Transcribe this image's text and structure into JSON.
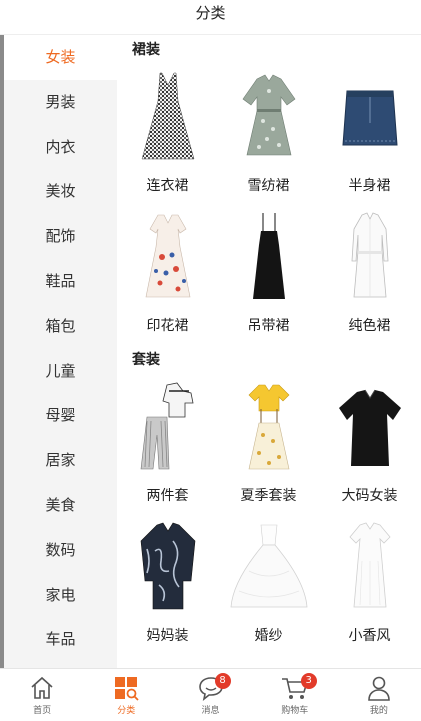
{
  "header": {
    "title": "分类"
  },
  "sidebar": {
    "items": [
      {
        "label": "女装",
        "active": true
      },
      {
        "label": "男装"
      },
      {
        "label": "内衣"
      },
      {
        "label": "美妆"
      },
      {
        "label": "配饰"
      },
      {
        "label": "鞋品"
      },
      {
        "label": "箱包"
      },
      {
        "label": "儿童"
      },
      {
        "label": "母婴"
      },
      {
        "label": "居家"
      },
      {
        "label": "美食"
      },
      {
        "label": "数码"
      },
      {
        "label": "家电"
      },
      {
        "label": "车品"
      }
    ]
  },
  "main": {
    "sections": [
      {
        "title": "裙装",
        "items": [
          {
            "label": "连衣裙",
            "icon": "gingham-dress"
          },
          {
            "label": "雪纺裙",
            "icon": "chiffon-dress"
          },
          {
            "label": "半身裙",
            "icon": "denim-skirt"
          },
          {
            "label": "印花裙",
            "icon": "print-dress"
          },
          {
            "label": "吊带裙",
            "icon": "slip-dress"
          },
          {
            "label": "纯色裙",
            "icon": "solid-dress"
          }
        ]
      },
      {
        "title": "套装",
        "items": [
          {
            "label": "两件套",
            "icon": "two-piece-set"
          },
          {
            "label": "夏季套装",
            "icon": "summer-set"
          },
          {
            "label": "大码女装",
            "icon": "plus-size-top"
          },
          {
            "label": "妈妈装",
            "icon": "mom-blouse"
          },
          {
            "label": "婚纱",
            "icon": "wedding-gown"
          },
          {
            "label": "小香风",
            "icon": "chanel-style-dress"
          }
        ]
      }
    ]
  },
  "tabbar": {
    "tabs": [
      {
        "label": "首页",
        "icon": "home-icon"
      },
      {
        "label": "分类",
        "icon": "category-icon",
        "active": true
      },
      {
        "label": "消息",
        "icon": "message-icon",
        "badge": "8"
      },
      {
        "label": "购物车",
        "icon": "cart-icon",
        "badge": "3"
      },
      {
        "label": "我的",
        "icon": "profile-icon"
      }
    ]
  },
  "colors": {
    "accent": "#ee6a22",
    "badge": "#e23b2a",
    "sidebar_bg": "#f4f4f4"
  }
}
